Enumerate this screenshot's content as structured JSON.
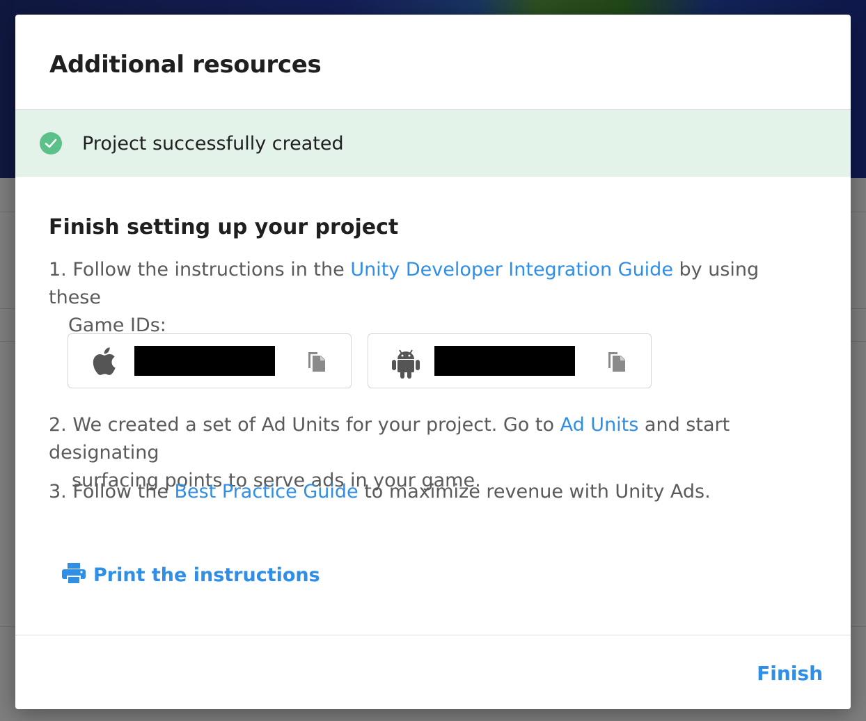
{
  "modal": {
    "title": "Additional resources",
    "banner_text": "Project successfully created",
    "section_title": "Finish setting up your project",
    "steps": [
      {
        "num": "1.",
        "before": "Follow the instructions in the ",
        "link": "Unity Developer Integration Guide",
        "after_line1": " by using these",
        "line2": "Game IDs:"
      },
      {
        "num": "2.",
        "before": "We created a set of Ad Units for your project. Go to ",
        "link": "Ad Units",
        "after_line1": " and start designating",
        "line2": "surfacing points to serve ads in your game."
      },
      {
        "num": "3.",
        "before": "Follow the ",
        "link": "Best Practice Guide",
        "after_line1": " to maximize revenue with Unity Ads."
      }
    ],
    "game_ids": [
      {
        "platform_icon": "apple-icon",
        "copy_icon": "copy-icon"
      },
      {
        "platform_icon": "android-icon",
        "copy_icon": "copy-icon"
      }
    ],
    "print_label": "Print the instructions",
    "finish_label": "Finish"
  },
  "colors": {
    "accent": "#2f8ee6",
    "success_banner": "#e3f3ea",
    "success_icon": "#5cc08a"
  }
}
